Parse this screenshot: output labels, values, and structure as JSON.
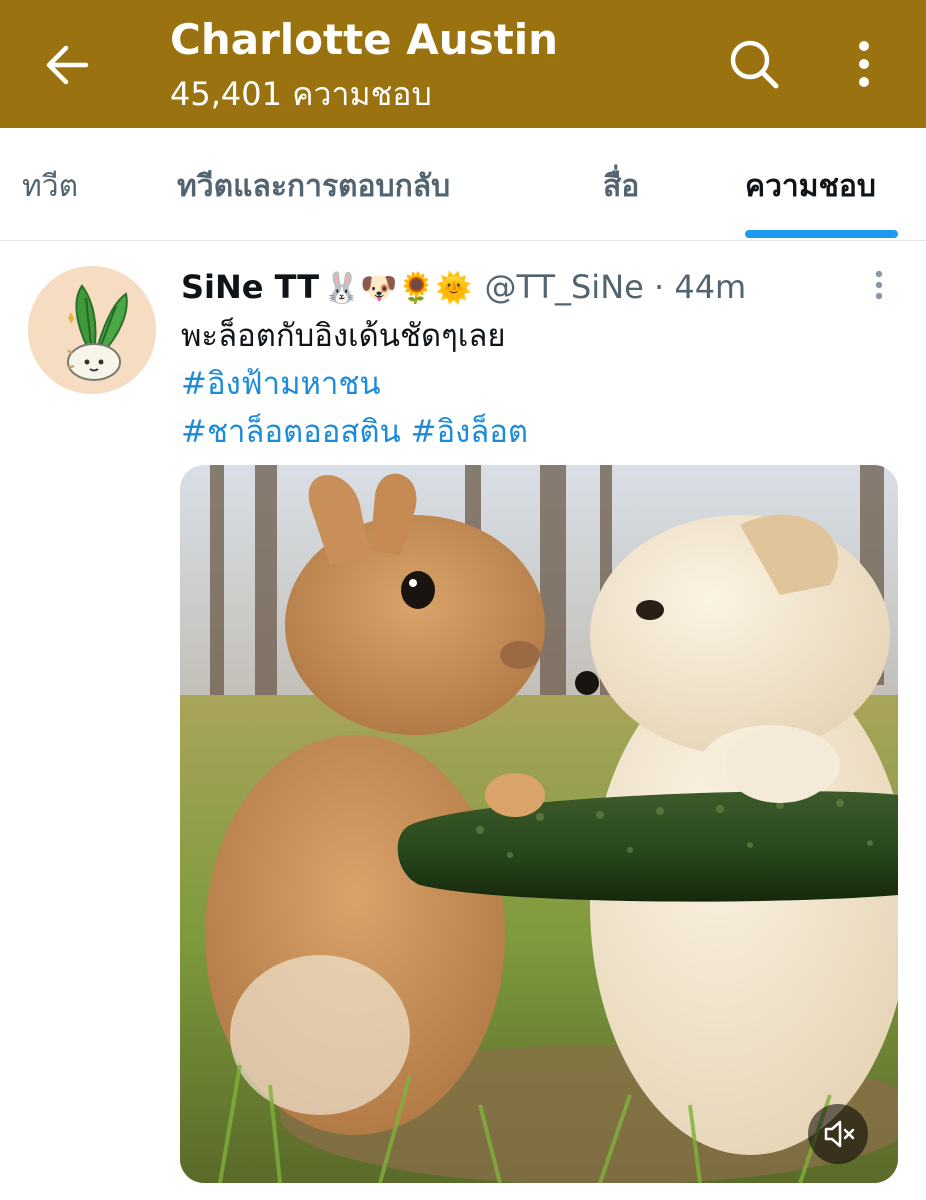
{
  "header": {
    "title": "Charlotte Austin",
    "subtitle": "45,401 ความชอบ",
    "bg_color": "#9a7210",
    "icons": [
      "arrow-left-icon",
      "search-icon",
      "more-vertical-icon"
    ]
  },
  "tabs": [
    {
      "label": "ทวีต",
      "active": false
    },
    {
      "label": "ทวีตและการตอบกลับ",
      "active": false
    },
    {
      "label": "สื่อ",
      "active": false
    },
    {
      "label": "ความชอบ",
      "active": true
    }
  ],
  "tweet": {
    "display_name": "SiNe TT",
    "name_emojis": "🐰🐶🌻🌞",
    "handle": "@TT_SiNe",
    "time": " · 44m",
    "text": "พะล็อตกับอิงเด้นชัดๆเลย",
    "hashtag_1": "#อิงฟ้ามหาชน",
    "hashtag_2": "#ชาล็อตออสติน",
    "hashtag_3": "#อิงล็อต",
    "media": {
      "description": "video",
      "mute_icon": "speaker-muted-icon"
    }
  },
  "colors": {
    "accent": "#1d9bf0",
    "hashtag": "#1d8cd8",
    "secondary_text": "#536471"
  }
}
